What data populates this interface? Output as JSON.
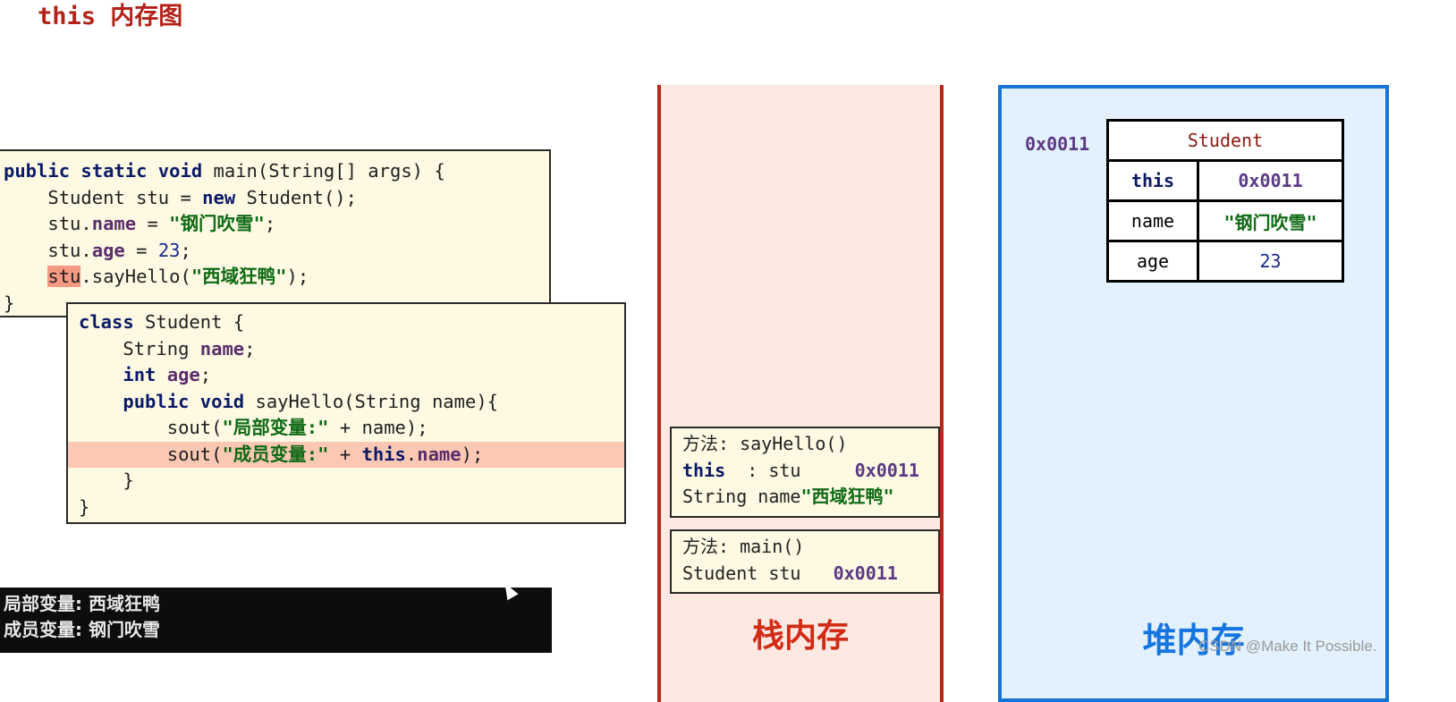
{
  "title": {
    "keyword": "this",
    "text": "内存图",
    "color": "#b3231a"
  },
  "code_main": {
    "lines": [
      [
        {
          "t": "public static void",
          "c": "kw"
        },
        {
          "t": " main(String[] args) {",
          "c": ""
        }
      ],
      [
        {
          "t": "    Student stu = ",
          "c": ""
        },
        {
          "t": "new",
          "c": "kw"
        },
        {
          "t": " Student();",
          "c": ""
        }
      ],
      [
        {
          "t": "    stu.",
          "c": ""
        },
        {
          "t": "name",
          "c": "field"
        },
        {
          "t": " = ",
          "c": ""
        },
        {
          "t": "\"钢门吹雪\"",
          "c": "str"
        },
        {
          "t": ";",
          "c": ""
        }
      ],
      [
        {
          "t": "    stu.",
          "c": ""
        },
        {
          "t": "age",
          "c": "field"
        },
        {
          "t": " = ",
          "c": ""
        },
        {
          "t": "23",
          "c": "num"
        },
        {
          "t": ";",
          "c": ""
        }
      ],
      [
        {
          "t": "    ",
          "c": ""
        },
        {
          "t": "stu",
          "c": "hl-token"
        },
        {
          "t": ".sayHello(",
          "c": ""
        },
        {
          "t": "\"西域狂鸭\"",
          "c": "str"
        },
        {
          "t": ");",
          "c": ""
        }
      ],
      [
        {
          "t": "}",
          "c": ""
        }
      ]
    ]
  },
  "code_class": {
    "highlight_line": 5,
    "lines": [
      [
        {
          "t": "class",
          "c": "kw"
        },
        {
          "t": " Student {",
          "c": ""
        }
      ],
      [
        {
          "t": "    String ",
          "c": ""
        },
        {
          "t": "name",
          "c": "field"
        },
        {
          "t": ";",
          "c": ""
        }
      ],
      [
        {
          "t": "    ",
          "c": ""
        },
        {
          "t": "int",
          "c": "kw"
        },
        {
          "t": " ",
          "c": ""
        },
        {
          "t": "age",
          "c": "field"
        },
        {
          "t": ";",
          "c": ""
        }
      ],
      [
        {
          "t": "    ",
          "c": ""
        },
        {
          "t": "public void",
          "c": "kw"
        },
        {
          "t": " sayHello(String name){",
          "c": ""
        }
      ],
      [
        {
          "t": "        sout(",
          "c": ""
        },
        {
          "t": "\"局部变量:\"",
          "c": "str"
        },
        {
          "t": " + name);",
          "c": ""
        }
      ],
      [
        {
          "t": "        sout(",
          "c": ""
        },
        {
          "t": "\"成员变量:\"",
          "c": "str"
        },
        {
          "t": " + ",
          "c": ""
        },
        {
          "t": "this",
          "c": "kw"
        },
        {
          "t": ".",
          "c": ""
        },
        {
          "t": "name",
          "c": "field"
        },
        {
          "t": ");",
          "c": ""
        }
      ],
      [
        {
          "t": "    }",
          "c": ""
        }
      ],
      [
        {
          "t": "}",
          "c": ""
        }
      ]
    ]
  },
  "console": {
    "lines": [
      "局部变量: 西域狂鸭",
      "成员变量: 钢门吹雪"
    ]
  },
  "stack": {
    "label": "栈内存",
    "frames": {
      "sayHello": {
        "method_label": "方法: sayHello()",
        "this_kw": "this",
        "this_rest": "  : stu     ",
        "this_addr": "0x0011",
        "param_prefix": "String name",
        "param_value": "\"西域狂鸭\""
      },
      "main": {
        "method_label": "方法: main()",
        "var_prefix": "Student stu   ",
        "var_addr": "0x0011"
      }
    }
  },
  "heap": {
    "label": "堆内存",
    "object_address": "0x0011",
    "object": {
      "class_name": "Student",
      "rows": [
        {
          "key": "this",
          "value": "0x0011"
        },
        {
          "key": "name",
          "value": "\"钢门吹雪\""
        },
        {
          "key": "age",
          "value": "23"
        }
      ]
    }
  },
  "watermark": "CSDN @Make It Possible."
}
